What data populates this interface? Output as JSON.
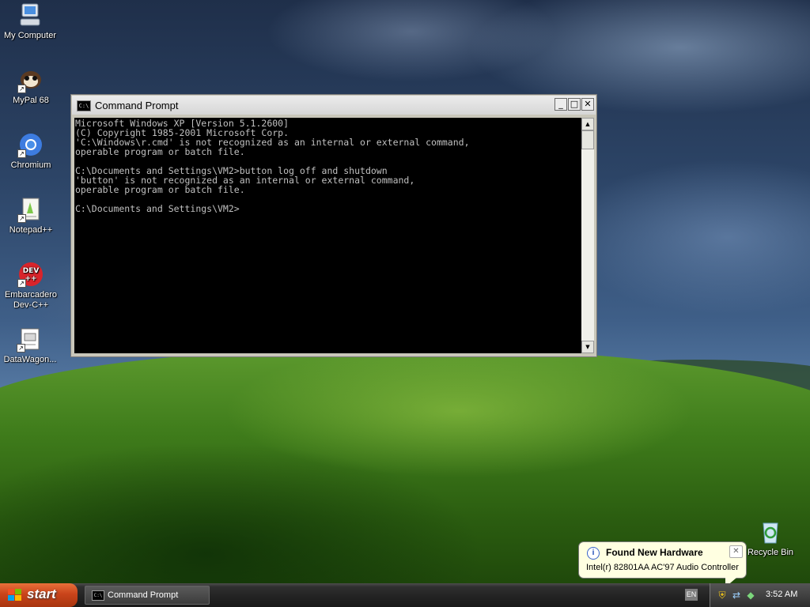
{
  "desktop": {
    "icons": [
      {
        "label": "My Computer",
        "icon": "my-computer-icon"
      },
      {
        "label": "MyPal 68",
        "icon": "mypal-icon"
      },
      {
        "label": "Chromium",
        "icon": "chromium-icon"
      },
      {
        "label": "Notepad++",
        "icon": "notepad-plus-plus-icon"
      },
      {
        "label": "Embarcadero Dev-C++",
        "icon": "devcpp-icon",
        "badge": "DEV\n++"
      },
      {
        "label": "DataWagon...",
        "icon": "datawagon-icon"
      },
      {
        "label": "Recycle Bin",
        "icon": "recycle-bin-icon"
      }
    ]
  },
  "cmd_window": {
    "title": "Command Prompt",
    "icon_text": "C:\\",
    "buttons": {
      "minimize": "_",
      "maximize": "□",
      "close": "✕"
    },
    "console_lines": [
      "Microsoft Windows XP [Version 5.1.2600]",
      "(C) Copyright 1985-2001 Microsoft Corp.",
      "'C:\\Windows\\r.cmd' is not recognized as an internal or external command,",
      "operable program or batch file.",
      "",
      "C:\\Documents and Settings\\VM2>button log off and shutdown",
      "'button' is not recognized as an internal or external command,",
      "operable program or batch file.",
      "",
      "C:\\Documents and Settings\\VM2>"
    ],
    "scroll": {
      "up": "▲",
      "down": "▼"
    }
  },
  "balloon": {
    "title": "Found New Hardware",
    "body": "Intel(r) 82801AA AC'97 Audio Controller",
    "info_glyph": "i",
    "close_glyph": "✕"
  },
  "taskbar": {
    "start_label": "start",
    "tasks": [
      {
        "label": "Command Prompt",
        "icon_text": "C:\\"
      }
    ],
    "language": "EN",
    "tray_icons": [
      "security-shield-icon",
      "network-icon",
      "hardware-icon"
    ],
    "clock": "3:52 AM"
  },
  "colors": {
    "console_bg": "#000000",
    "console_fg": "#c0c0c0",
    "start_orange": "#c9441b",
    "balloon_bg": "#ffffe1"
  }
}
